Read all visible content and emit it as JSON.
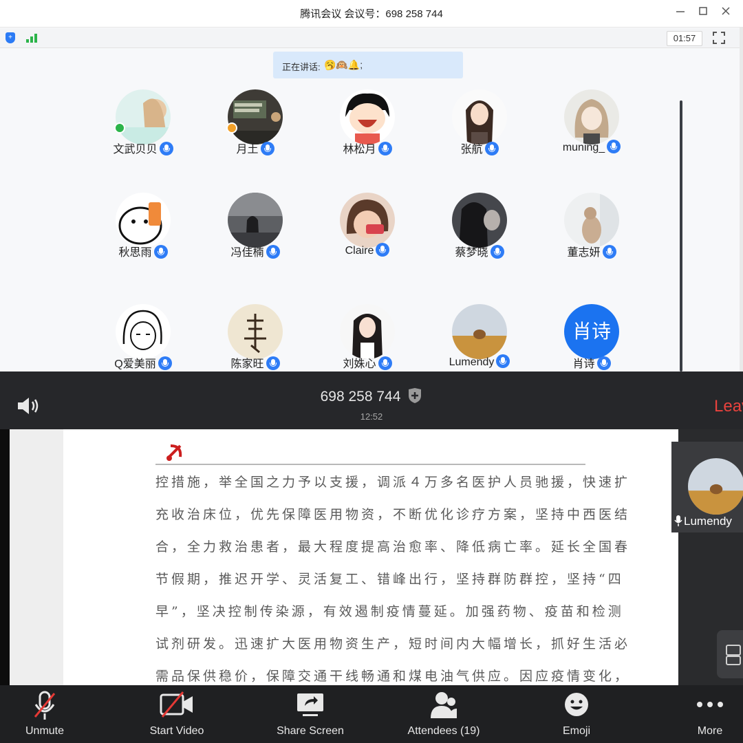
{
  "window": {
    "title": "腾讯会议 会议号：698 258 744",
    "controls": [
      "minimize-icon",
      "maximize-icon",
      "close-icon"
    ],
    "timer": "01:57"
  },
  "speaking": {
    "label": "正在讲话:",
    "value": "🥱🙉🔔;"
  },
  "participants": [
    {
      "name": "文武贝贝",
      "host": "host"
    },
    {
      "name": "月土",
      "host": "cohost"
    },
    {
      "name": "林松月"
    },
    {
      "name": "张航"
    },
    {
      "name": "muning_"
    },
    {
      "name": "秋思雨"
    },
    {
      "name": "冯佳楠"
    },
    {
      "name": "Claire"
    },
    {
      "name": "蔡梦晓"
    },
    {
      "name": "董志妍"
    },
    {
      "name": "Q爱美丽"
    },
    {
      "name": "陈家旺"
    },
    {
      "name": "刘姝心"
    },
    {
      "name": "Lumendy"
    },
    {
      "name": "肖诗",
      "avatar_text": "肖诗"
    }
  ],
  "mobile": {
    "meeting_number": "698 258 744",
    "time": "12:52",
    "leave": "Leave",
    "thumb_name": "Lumendy",
    "doc": {
      "lines": [
        "控措施，举全国之力予以支援，调派４万多名医护人员驰援，快速扩",
        "充收治床位，优先保障医用物资，不断优化诊疗方案，坚持中西医结",
        "合，全力救治患者，最大程度提高治愈率、降低病亡率。延长全国春",
        "节假期，推迟开学、灵活复工、错峰出行，坚持群防群控，坚持“四",
        "早”，坚决控制传染源，有效遏制疫情蔓延。加强药物、疫苗和检测",
        "试剂研发。迅速扩大医用物资生产，短时间内大幅增长，抓好生活必",
        "需品保供稳价，保障交通干线畅通和煤电油气供应。因应疫情变化，"
      ]
    },
    "toolbar": {
      "unmute": "Unmute",
      "start_video": "Start Video",
      "share_screen": "Share Screen",
      "attendees": "Attendees (19)",
      "emoji": "Emoji",
      "more": "More"
    }
  }
}
